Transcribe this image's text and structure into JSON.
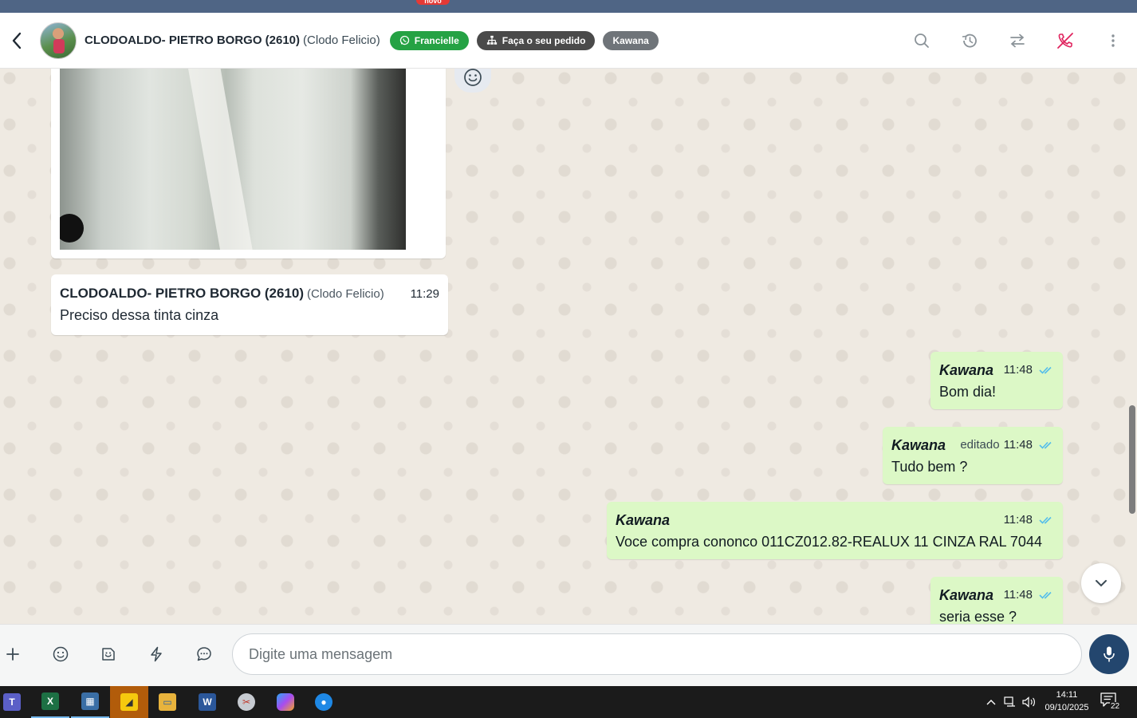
{
  "top_badge": "novo",
  "header": {
    "contact_name": "CLODOALDO- PIETRO BORGO (2610)",
    "contact_alias": "(Clodo Felicio)",
    "chips": {
      "agent": "Francielle",
      "order": "Faça o seu pedido",
      "tag": "Kawana"
    },
    "icons": [
      "search-icon",
      "history-icon",
      "transfer-icon",
      "end-call-icon",
      "more-vert-icon"
    ]
  },
  "messages": {
    "incoming": {
      "author": "CLODOALDO- PIETRO BORGO (2610)",
      "alias": "(Clodo Felicio)",
      "time": "11:29",
      "text": "Preciso dessa tinta cinza"
    },
    "outgoing": [
      {
        "author": "Kawana",
        "edited": "",
        "time": "11:48",
        "text": "Bom dia!"
      },
      {
        "author": "Kawana",
        "edited": "editado",
        "time": "11:48",
        "text": "Tudo bem ?"
      },
      {
        "author": "Kawana",
        "edited": "",
        "time": "11:48",
        "text": "Voce compra cononco 011CZ012.82-REALUX 11 CINZA RAL 7044"
      },
      {
        "author": "Kawana",
        "edited": "",
        "time": "11:48",
        "text": "seria esse ?"
      }
    ]
  },
  "composer": {
    "placeholder": "Digite uma mensagem"
  },
  "taskbar": {
    "apps": [
      "teams-icon",
      "excel-icon",
      "calculator-icon",
      "sticky-notes-icon",
      "file-explorer-icon",
      "word-icon",
      "snipping-tool-icon",
      "copilot-icon",
      "browser-icon"
    ],
    "time": "14:11",
    "date": "09/10/2025",
    "notifications": "22"
  },
  "colors": {
    "outgoing_bubble": "#dcf8c6",
    "incoming_bubble": "#ffffff",
    "chip_green": "#25a244",
    "mic_button": "#23466e",
    "read_ticks": "#53bdeb"
  }
}
